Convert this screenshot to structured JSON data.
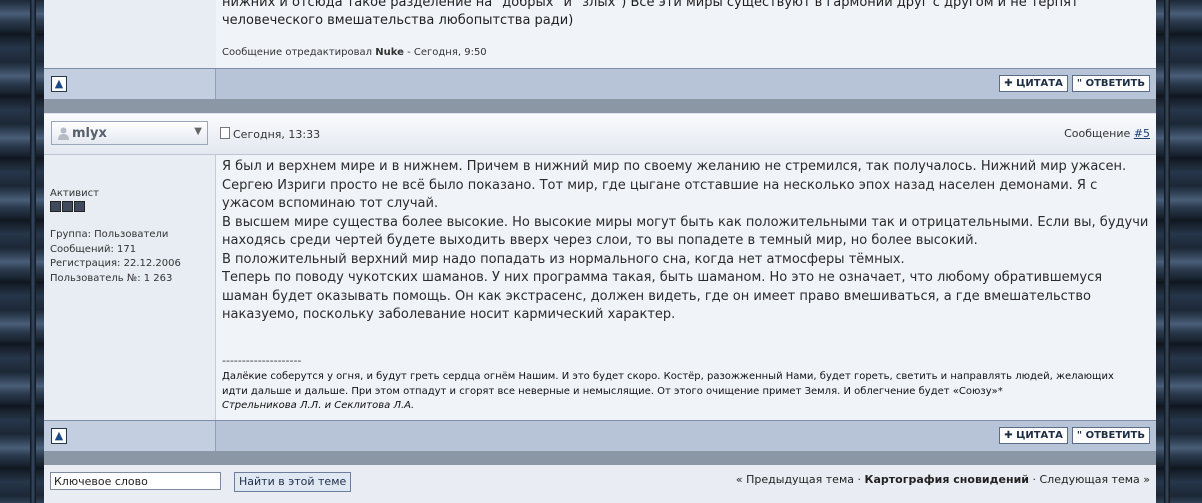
{
  "prev_post": {
    "text_partial": "нижних и отсюда такое разделение на \"добрых\" и \"злых\") Все эти миры существуют в гармонии друг с другом и не терпят человеческого вмешательства любопытства ради)",
    "edited_prefix": "Сообщение отредактировал",
    "edited_by": "Nuke",
    "edited_when": "- Сегодня, 9:50"
  },
  "buttons": {
    "quote": "ЦИТАТА",
    "reply": "ОТВЕТИТЬ",
    "quote_icon": "plus-icon",
    "reply_icon": "quote-marks-icon",
    "up_icon": "arrow-up-icon"
  },
  "post": {
    "username": "mlyx",
    "date": "Сегодня, 13:33",
    "number_label": "Сообщение",
    "number": "#5",
    "rank": "Активист",
    "group": "Группа: Пользователи",
    "messages": "Сообщений: 171",
    "registered": "Регистрация: 22.12.2006",
    "user_no": "Пользователь №: 1 263",
    "paragraphs": [
      "Я был и верхнем мире и в нижнем. Причем в нижний мир по своему желанию не стремился, так получалось. Нижний мир ужасен. Сергею Изриги просто не всё было показано. Тот мир, где цыгане отставшие на несколько эпох назад населен демонами. Я с ужасом вспоминаю тот случай.",
      "В высшем мире существа более высокие. Но высокие миры могут быть как положительными так и отрицательными. Если вы, будучи находясь среди чертей будете выходить вверх через слои, то вы попадете в темный мир, но более высокий.",
      "В положительный верхний мир надо попадать из нормального сна, когда нет атмосферы тёмных.",
      "Теперь по поводу чукотских шаманов. У них программа такая, быть шаманом. Но это не означает, что любому обратившемуся шаман будет оказывать помощь. Он как экстрасенс, должен видеть, где он имеет право вмешиваться, а где вмешательство наказуемо, поскольку заболевание носит кармический характер."
    ],
    "signature_sep": "--------------------",
    "signature": "Далёкие соберутся у огня, и будут греть сердца огнём Нашим. И это будет скоро. Костёр, разожженный Нами, будет гореть, светить и направлять людей, желающих идти дальше и дальше. При этом отпадут и сгорят все неверные и немыслящие. От этого очищение примет Земля. И облегчение будет «Союзу»*",
    "signature_author": "Стрельникова Л.Л. и Секлитова Л.А."
  },
  "footer": {
    "search_value": "Ключевое слово",
    "search_button": "Найти в этой теме",
    "prev_topic": "« Предыдущая тема",
    "dot1": "·",
    "current_topic": "Картография сновидений",
    "dot2": "·",
    "next_topic": "Следующая тема »"
  }
}
